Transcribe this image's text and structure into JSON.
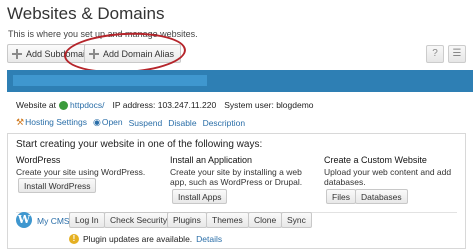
{
  "page": {
    "title": "Websites & Domains",
    "subtitle": "This is where you set up and manage websites."
  },
  "toolbar": {
    "add_subdomain": "Add Subdomain",
    "add_domain_alias": "Add Domain Alias",
    "help_icon": "?",
    "collapse_icon": "☰"
  },
  "domain": {
    "website_at_label": "Website at",
    "httpdocs": "httpdocs/",
    "ip_label": "IP address:",
    "ip_value": "103.247.11.220",
    "system_user_label": "System user:",
    "system_user_value": "blogdemo"
  },
  "actions": {
    "hosting_settings": "Hosting Settings",
    "open": "Open",
    "suspend": "Suspend",
    "disable": "Disable",
    "description": "Description"
  },
  "start": {
    "heading": "Start creating your website in one of the following ways:",
    "wordpress": {
      "title": "WordPress",
      "desc": "Create your site using WordPress.",
      "button": "Install WordPress"
    },
    "application": {
      "title": "Install an Application",
      "desc": "Create your site by installing a web app, such as WordPress or Drupal.",
      "button": "Install Apps"
    },
    "custom": {
      "title": "Create a Custom Website",
      "desc": "Upload your web content and add databases.",
      "files_button": "Files",
      "databases_button": "Databases"
    }
  },
  "cms": {
    "logo": "W",
    "name": "My CMS",
    "buttons": [
      "Log In",
      "Check Security",
      "Plugins",
      "Themes",
      "Clone",
      "Sync"
    ],
    "warning": "Plugin updates are available.",
    "details": "Details"
  },
  "colors": {
    "domain_bar": "#2e7fb4",
    "link": "#2a6ea8",
    "highlight": "#b5252b"
  }
}
